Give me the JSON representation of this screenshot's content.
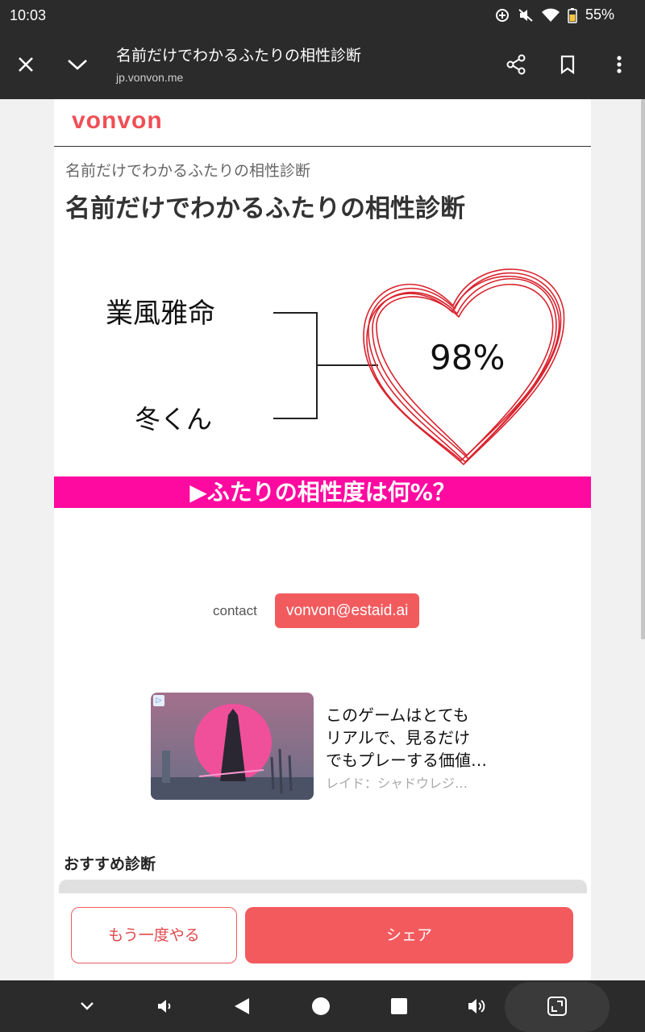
{
  "status": {
    "time": "10:03",
    "battery": "55%"
  },
  "toolbar": {
    "title": "名前だけでわかるふたりの相性診断",
    "url": "jp.vonvon.me"
  },
  "page": {
    "logo": "vonvon",
    "subtitle": "名前だけでわかるふたりの相性診断",
    "title": "名前だけでわかるふたりの相性診断",
    "result": {
      "name1": "業風雅命",
      "name2": "冬くん",
      "percent": "98%"
    },
    "banner": "▶ふたりの相性度は何%？",
    "contact_label": "contact",
    "contact_email": "vonvon@estaid.ai",
    "ad": {
      "title_lines": [
        "このゲームはとても",
        "リアルで、見るだけ",
        "でもプレーする価値…"
      ],
      "source": "レイド：シャドウレジ…"
    },
    "recommend_heading": "おすすめ診断"
  },
  "actions": {
    "retry": "もう一度やる",
    "share": "シェア"
  },
  "colors": {
    "brand": "#ef4f56",
    "banner": "#ff0aa0",
    "heart": "#d9232e"
  }
}
